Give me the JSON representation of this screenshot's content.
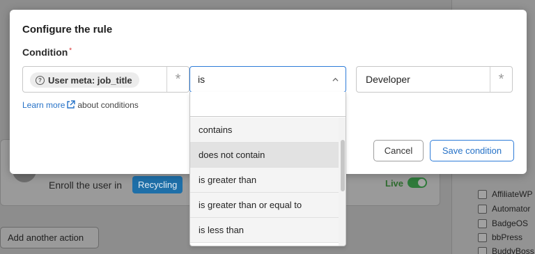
{
  "background": {
    "enroll_text": "Enroll the user in",
    "course_tag": "Recycling",
    "live_label": "Live",
    "add_action_button": "Add another action",
    "sidebar_items": [
      "AffiliateWP",
      "Automator",
      "BadgeOS",
      "bbPress",
      "BuddyBoss"
    ]
  },
  "modal": {
    "title": "Configure the rule",
    "condition_label": "Condition",
    "required_mark": "*",
    "field": {
      "tag_label": "User meta: job_title",
      "icon": "user-meta-icon",
      "asterisk": "*"
    },
    "operator": {
      "selected": "is",
      "search_placeholder": "",
      "options": [
        "contains",
        "does not contain",
        "is greater than",
        "is greater than or equal to",
        "is less than"
      ],
      "hovered_option_index": 1
    },
    "value": {
      "text": "Developer",
      "asterisk": "*"
    },
    "learn_more": {
      "link_text": "Learn more",
      "suffix": "about conditions"
    },
    "buttons": {
      "cancel": "Cancel",
      "save": "Save condition"
    }
  },
  "colors": {
    "accent": "#2d7bd8",
    "link": "#2672c7",
    "required": "#e25c5c",
    "overlay": "#8d8d8d"
  }
}
